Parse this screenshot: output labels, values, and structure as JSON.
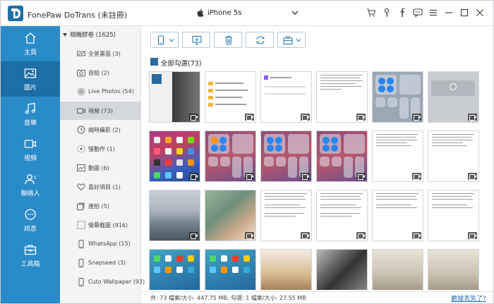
{
  "app": {
    "title": "FonePaw DoTrans (未註冊)",
    "device": "iPhone 5s",
    "brand_color": "#2a8bc9"
  },
  "titlebar_icons": [
    "cart-icon",
    "key-icon",
    "facebook-icon",
    "chat-icon",
    "menu-icon",
    "minimize-icon",
    "maximize-icon",
    "close-icon"
  ],
  "nav": [
    {
      "label": "主頁",
      "icon": "home-icon"
    },
    {
      "label": "圖片",
      "icon": "image-icon",
      "active": true
    },
    {
      "label": "音樂",
      "icon": "music-icon"
    },
    {
      "label": "視頻",
      "icon": "video-icon"
    },
    {
      "label": "聯絡人",
      "icon": "contacts-icon"
    },
    {
      "label": "訊息",
      "icon": "message-icon"
    },
    {
      "label": "工具箱",
      "icon": "toolbox-icon"
    }
  ],
  "categories": {
    "root": "相機膠卷 (1625)",
    "items": [
      {
        "label": "全景畫面 (3)",
        "icon": "panorama-icon"
      },
      {
        "label": "自拍 (2)",
        "icon": "selfie-icon"
      },
      {
        "label": "Live Photos (54)",
        "icon": "live-photo-icon"
      },
      {
        "label": "視頻 (73)",
        "icon": "video-icon",
        "active": true
      },
      {
        "label": "縮時攝影 (2)",
        "icon": "timelapse-icon"
      },
      {
        "label": "慢動作 (1)",
        "icon": "slowmo-icon"
      },
      {
        "label": "動圖 (6)",
        "icon": "animated-icon"
      },
      {
        "label": "喜好項目 (1)",
        "icon": "heart-icon"
      },
      {
        "label": "連拍 (5)",
        "icon": "burst-icon"
      },
      {
        "label": "螢幕截圖 (916)",
        "icon": "screenshot-icon"
      },
      {
        "label": "WhatsApp (15)",
        "icon": "phone-icon"
      },
      {
        "label": "Snapseed (3)",
        "icon": "phone-icon"
      },
      {
        "label": "Cuto Wallpaper (93)",
        "icon": "phone-icon"
      }
    ]
  },
  "toolbar": {
    "buttons": [
      "export-to-device-button",
      "export-to-pc-button",
      "delete-button",
      "refresh-button",
      "toolbox-button"
    ]
  },
  "select_all": "全部勾選(73)",
  "status": {
    "summary": "共: 73 檔案/大小: 447.75 MB; 勾選: 1 檔案/大小: 27.55 MB",
    "link": "數據丟失了?"
  }
}
